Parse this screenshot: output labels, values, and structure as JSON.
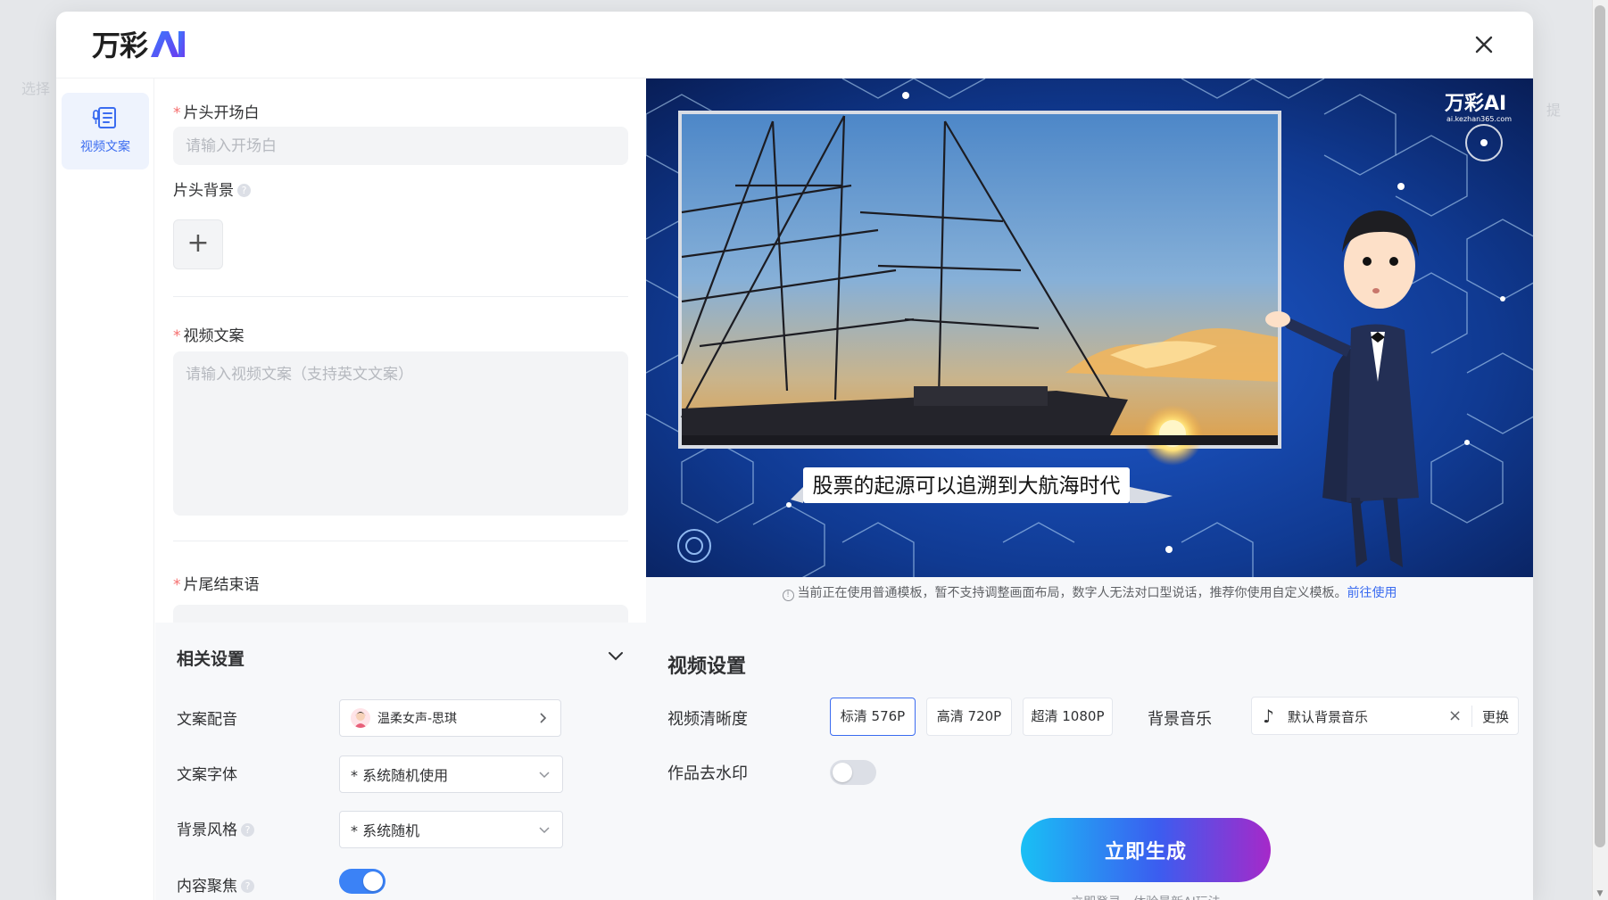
{
  "modal": {
    "logo_text": "万彩",
    "close_icon": "close-icon"
  },
  "side_nav": {
    "items": [
      {
        "label": "视频文案",
        "icon": "document-mic-icon",
        "active": true
      }
    ]
  },
  "form": {
    "opening": {
      "label": "片头开场白",
      "placeholder": "请输入开场白",
      "value": ""
    },
    "opening_bg": {
      "label": "片头背景"
    },
    "script": {
      "label": "视频文案",
      "placeholder": "请输入视频文案（支持英文文案）",
      "value": ""
    },
    "ending": {
      "label": "片尾结束语"
    }
  },
  "related_settings": {
    "title": "相关设置",
    "voice": {
      "label": "文案配音",
      "value": "温柔女声-思琪"
    },
    "font": {
      "label": "文案字体",
      "value": "* 系统随机使用"
    },
    "bg_style": {
      "label": "背景风格",
      "value": "* 系统随机"
    },
    "focus": {
      "label": "内容聚焦",
      "enabled": true
    }
  },
  "preview": {
    "watermark_brand": "万彩AI",
    "watermark_url": "ai.kezhan365.com",
    "subtitle": "股票的起源可以追溯到大航海时代"
  },
  "notice": {
    "text": "当前正在使用普通模板，暂不支持调整画面布局，数字人无法对口型说话，推荐你使用自定义模板。",
    "link": "前往使用"
  },
  "video_settings": {
    "title": "视频设置",
    "resolution_label": "视频清晰度",
    "resolutions": [
      "标清 576P",
      "高清 720P",
      "超清 1080P"
    ],
    "selected_resolution": "标清 576P",
    "music_label": "背景音乐",
    "music_value": "默认背景音乐",
    "music_replace": "更换",
    "watermark_label": "作品去水印",
    "watermark_enabled": false,
    "generate_label": "立即生成",
    "login_hint": "立即登录，体验最新AI玩法"
  },
  "colors": {
    "accent": "#3b6cf0",
    "required": "#f56c6c",
    "toggle_on": "#3b82f6",
    "toggle_off": "#dcdfe6"
  }
}
